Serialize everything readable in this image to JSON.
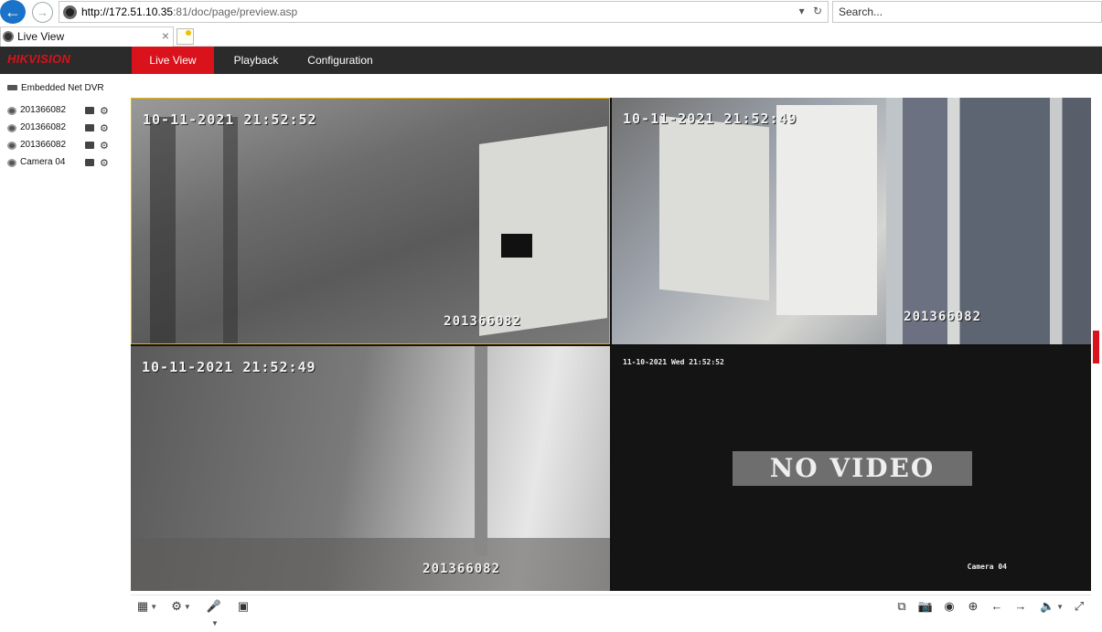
{
  "browser": {
    "url_host": "http://172.51.10.35",
    "url_rest": ":81/doc/page/preview.asp",
    "search_placeholder": "Search...",
    "tab_title": "Live View"
  },
  "app": {
    "logo": "HIKVISION",
    "menu": {
      "live_view": "Live View",
      "playback": "Playback",
      "configuration": "Configuration"
    },
    "accent_color": "#d9121b"
  },
  "tree": {
    "root": "Embedded Net DVR",
    "cameras": [
      {
        "label": "201366082"
      },
      {
        "label": "201366082"
      },
      {
        "label": "201366082"
      },
      {
        "label": "Camera 04"
      }
    ]
  },
  "video": {
    "windows": [
      {
        "timestamp": "10-11-2021 21:52:52",
        "name": "201366082"
      },
      {
        "timestamp": "10-11-2021 21:52:49",
        "name": "201366082"
      },
      {
        "timestamp": "10-11-2021 21:52:49",
        "name": "201366082"
      },
      {
        "timestamp": "11-10-2021 Wed 21:52:52",
        "name": "Camera 04",
        "status": "NO VIDEO"
      }
    ]
  },
  "icons": {
    "back": "back-arrow-icon",
    "forward": "forward-arrow-icon",
    "refresh": "refresh-icon",
    "layout": "grid-layout-icon",
    "ptz": "ptz-icon",
    "microphone": "microphone-icon",
    "capture": "camera-capture-icon",
    "record": "record-icon",
    "zoom": "zoom-icon",
    "audio": "speaker-icon",
    "fullscreen": "fullscreen-icon"
  }
}
